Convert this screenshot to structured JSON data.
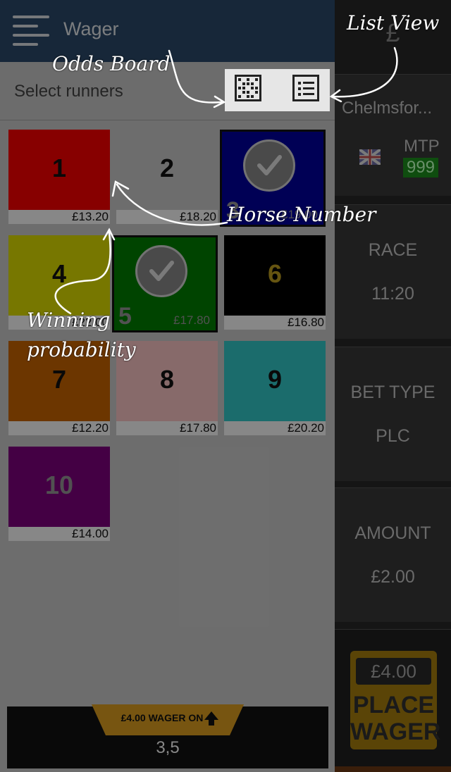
{
  "header": {
    "title": "Wager",
    "select_label": "Select runners"
  },
  "runners": [
    {
      "number": "1",
      "odds": "£13.20",
      "color": "#ff0000",
      "text_color": "#111111",
      "selected": false
    },
    {
      "number": "2",
      "odds": "£18.20",
      "color": "#cfcfcf",
      "text_color": "#111111",
      "selected": false
    },
    {
      "number": "3",
      "odds": "£19.00",
      "color": "#0000a0",
      "text_color": "#9a9a9a",
      "selected": true
    },
    {
      "number": "4",
      "odds": "£22.00",
      "color": "#e0e000",
      "text_color": "#111111",
      "selected": false
    },
    {
      "number": "5",
      "odds": "£17.80",
      "color": "#008000",
      "text_color": "#9a9a9a",
      "selected": true
    },
    {
      "number": "6",
      "odds": "£16.80",
      "color": "#000000",
      "text_color": "#c0a020",
      "selected": false
    },
    {
      "number": "7",
      "odds": "£12.20",
      "color": "#cc6600",
      "text_color": "#111111",
      "selected": false
    },
    {
      "number": "8",
      "odds": "£17.80",
      "color": "#ffc8c8",
      "text_color": "#111111",
      "selected": false
    },
    {
      "number": "9",
      "odds": "£20.20",
      "color": "#33cccc",
      "text_color": "#111111",
      "selected": false
    },
    {
      "number": "10",
      "odds": "£14.00",
      "color": "#800080",
      "text_color": "#9a9a9a",
      "selected": false
    }
  ],
  "wager_bar": {
    "tab_label": "£4.00 WAGER ON",
    "selection": "3,5",
    "tab_color": "#e0a020"
  },
  "sidebar": {
    "currency": "£",
    "track": "Chelmsfor...",
    "flag": "uk-flag",
    "mtp_label": "MTP",
    "mtp_value": "999",
    "race_label": "RACE",
    "race_time": "11:20",
    "bet_type_label": "BET TYPE",
    "bet_type_value": "PLC",
    "amount_label": "AMOUNT",
    "amount_value": "£2.00",
    "place_amount": "£4.00",
    "place_label": "PLACE WAGER"
  },
  "annotations": {
    "odds_board": "Odds Board",
    "list_view": "List View",
    "horse_number": "Horse Number",
    "winning_prob": "Winning probability"
  },
  "icons": [
    "hamburger-icon",
    "grid-view-icon",
    "list-view-icon",
    "checkmark-icon",
    "up-arrow-icon",
    "uk-flag-icon"
  ]
}
